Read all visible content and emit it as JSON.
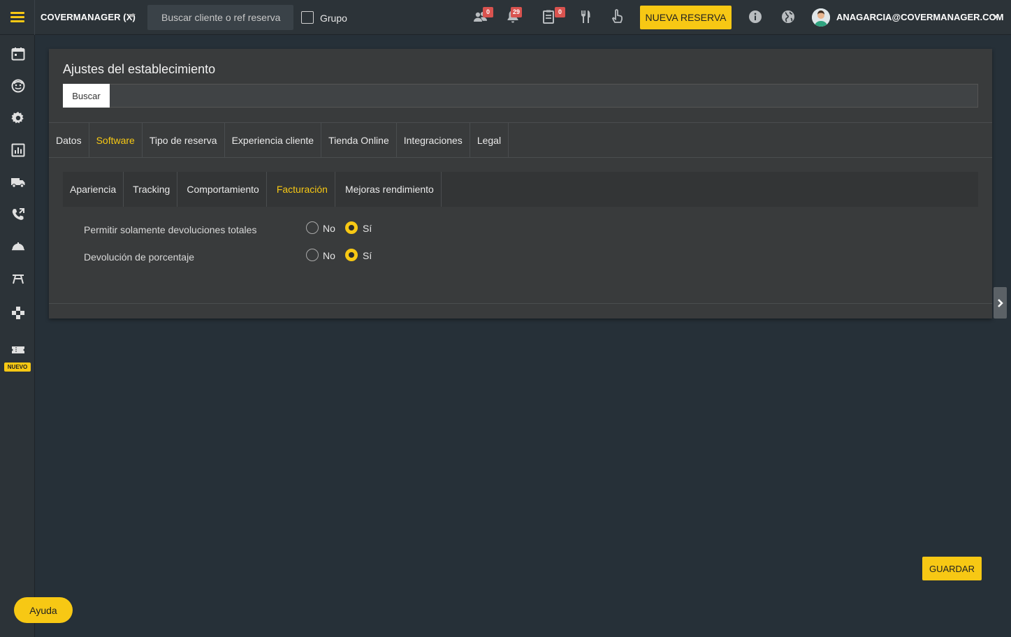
{
  "topbar": {
    "brand": "COVERMANAGER (X)",
    "search_placeholder": "Buscar cliente o ref reserva",
    "grupo_label": "Grupo",
    "badges": {
      "clients": "0",
      "notifications": "29",
      "tasks": "0"
    },
    "new_reservation_label": "NUEVA RESERVA",
    "user_email": "ANAGARCIA@COVERMANAGER.COM"
  },
  "sidebar": {
    "items": [
      "calendar-icon",
      "face-icon",
      "gear-icon",
      "chart-icon",
      "truck-icon",
      "phone-icon",
      "cloche-icon",
      "table-icon",
      "gamepad-icon",
      "ticket-icon"
    ],
    "nuevo_label": "NUEVO"
  },
  "panel": {
    "title": "Ajustes del establecimiento",
    "search_button": "Buscar",
    "tabs": [
      "Datos",
      "Software",
      "Tipo de reserva",
      "Experiencia cliente",
      "Tienda Online",
      "Integraciones",
      "Legal"
    ],
    "active_tab": "Software",
    "subtabs": [
      "Apariencia",
      "Tracking",
      "Comportamiento",
      "Facturación",
      "Mejoras rendimiento"
    ],
    "active_subtab": "Facturación",
    "settings": [
      {
        "label": "Permitir solamente devoluciones totales",
        "no": "No",
        "si": "Sí",
        "value": "Sí"
      },
      {
        "label": "Devolución de porcentaje",
        "no": "No",
        "si": "Sí",
        "value": "Sí"
      }
    ]
  },
  "footer": {
    "save_label": "GUARDAR",
    "help_label": "Ayuda"
  },
  "colors": {
    "accent": "#f7c814",
    "background": "#263038",
    "panel": "#393b3c",
    "badge": "#d9534f"
  }
}
